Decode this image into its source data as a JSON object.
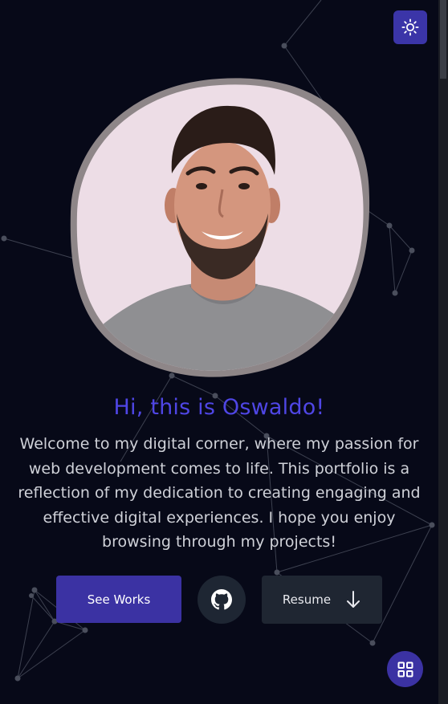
{
  "hero": {
    "title": "Hi, this is Oswaldo!",
    "intro": "Welcome to my digital corner, where my passion for web development comes to life. This portfolio is a reflection of my dedication to creating engaging and effective digital experiences. I hope you enjoy browsing through my projects!"
  },
  "actions": {
    "works_label": "See Works",
    "resume_label": "Resume"
  },
  "icons": {
    "theme": "sun-icon",
    "github": "github-icon",
    "resume": "arrow-down-icon",
    "menu": "grid-icon"
  },
  "colors": {
    "background": "#070918",
    "accent": "#3b32a3",
    "title": "#4f46e5",
    "secondary_button": "#1f2632"
  }
}
